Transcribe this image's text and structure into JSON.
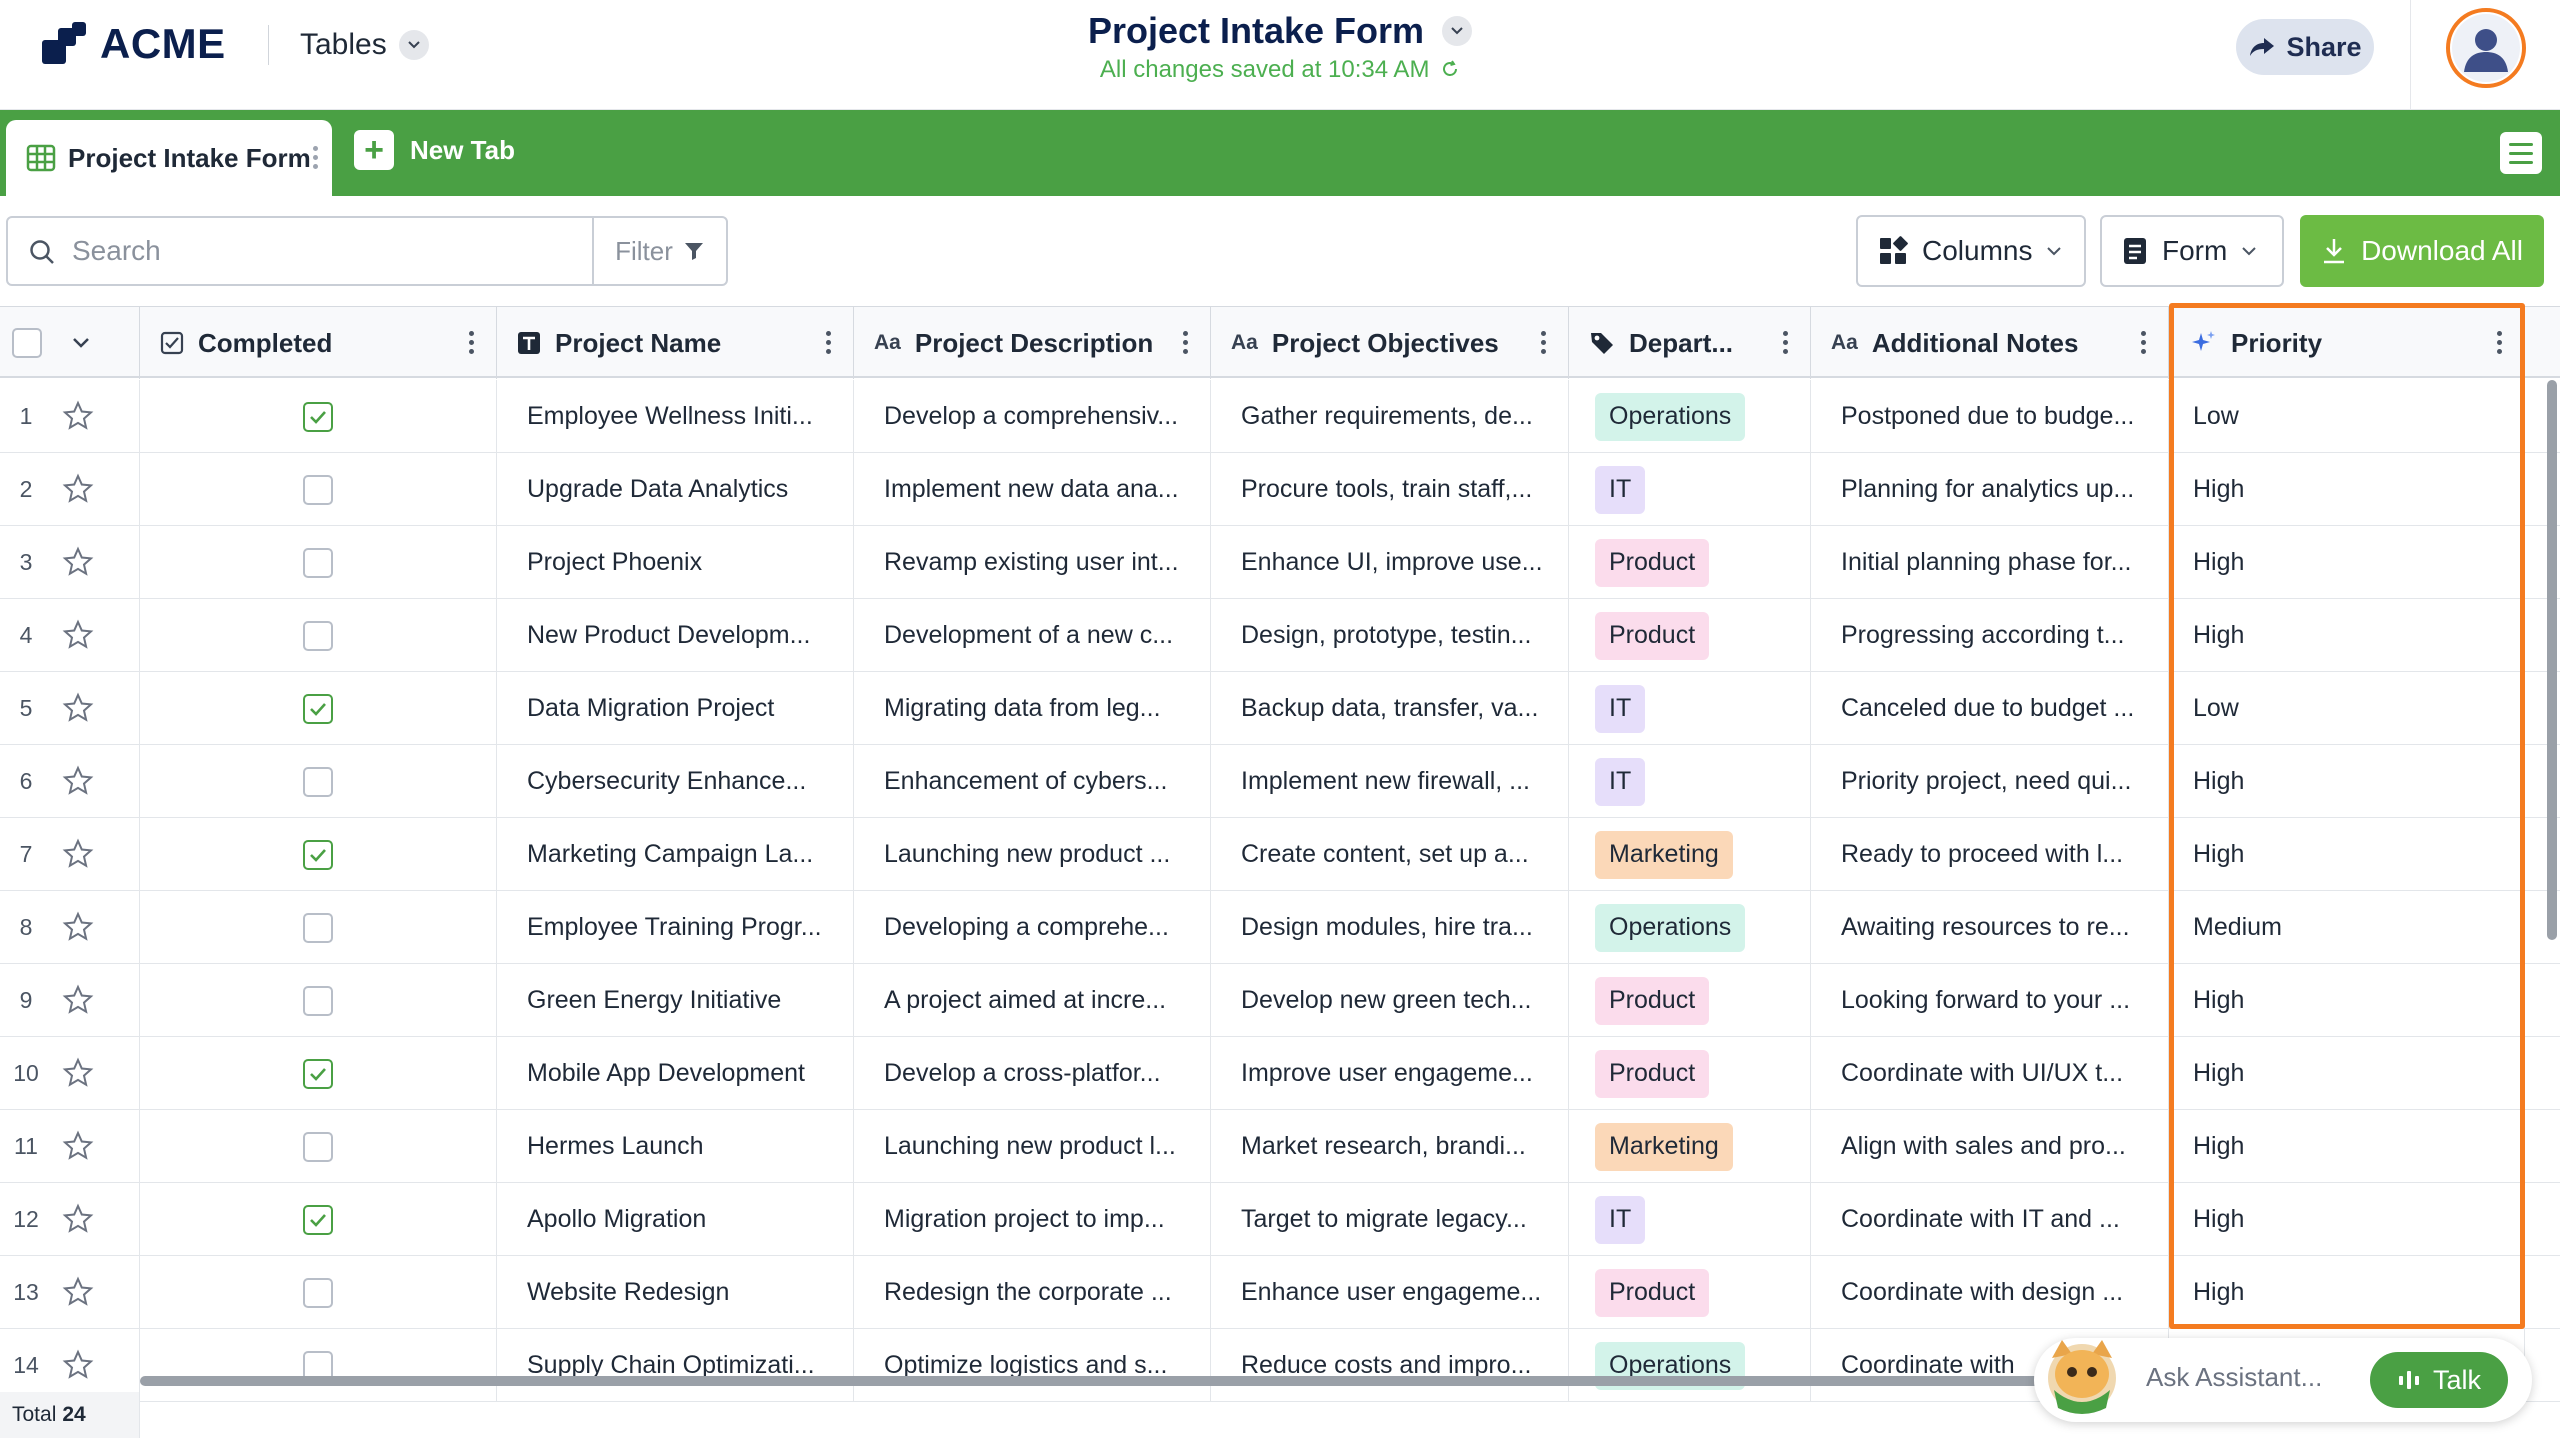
{
  "header": {
    "brand": "ACME",
    "tables_label": "Tables",
    "title": "Project Intake Form",
    "saved_status": "All changes saved at 10:34 AM",
    "share_label": "Share"
  },
  "tabs": {
    "active_label": "Project Intake Form",
    "new_tab_label": "New Tab"
  },
  "toolbar": {
    "search_placeholder": "Search",
    "filter_label": "Filter",
    "columns_label": "Columns",
    "form_label": "Form",
    "download_label": "Download All"
  },
  "columns": [
    {
      "label": "Completed",
      "icon": "checkbox-icon"
    },
    {
      "label": "Project Name",
      "icon": "text-t-icon"
    },
    {
      "label": "Project Description",
      "icon": "text-aa-icon"
    },
    {
      "label": "Project Objectives",
      "icon": "text-aa-icon"
    },
    {
      "label": "Depart...",
      "icon": "tag-icon"
    },
    {
      "label": "Additional Notes",
      "icon": "text-aa-icon"
    },
    {
      "label": "Priority",
      "icon": "sparkle-icon"
    }
  ],
  "rows": [
    {
      "num": "1",
      "completed": true,
      "name": "Employee Wellness Initi...",
      "description": "Develop a comprehensiv...",
      "objectives": "Gather requirements, de...",
      "department": "Operations",
      "notes": "Postponed due to budge...",
      "priority": "Low"
    },
    {
      "num": "2",
      "completed": false,
      "name": "Upgrade Data Analytics",
      "description": "Implement new data ana...",
      "objectives": "Procure tools, train staff,...",
      "department": "IT",
      "notes": "Planning for analytics up...",
      "priority": "High"
    },
    {
      "num": "3",
      "completed": false,
      "name": "Project Phoenix",
      "description": "Revamp existing user int...",
      "objectives": "Enhance UI, improve use...",
      "department": "Product",
      "notes": "Initial planning phase for...",
      "priority": "High"
    },
    {
      "num": "4",
      "completed": false,
      "name": "New Product Developm...",
      "description": "Development of a new c...",
      "objectives": "Design, prototype, testin...",
      "department": "Product",
      "notes": "Progressing according t...",
      "priority": "High"
    },
    {
      "num": "5",
      "completed": true,
      "name": "Data Migration Project",
      "description": "Migrating data from leg...",
      "objectives": "Backup data, transfer, va...",
      "department": "IT",
      "notes": "Canceled due to budget ...",
      "priority": "Low"
    },
    {
      "num": "6",
      "completed": false,
      "name": "Cybersecurity Enhance...",
      "description": "Enhancement of cybers...",
      "objectives": "Implement new firewall, ...",
      "department": "IT",
      "notes": "Priority project, need qui...",
      "priority": "High"
    },
    {
      "num": "7",
      "completed": true,
      "name": "Marketing Campaign La...",
      "description": "Launching new product ...",
      "objectives": "Create content, set up a...",
      "department": "Marketing",
      "notes": "Ready to proceed with l...",
      "priority": "High"
    },
    {
      "num": "8",
      "completed": false,
      "name": "Employee Training Progr...",
      "description": "Developing a comprehe...",
      "objectives": "Design modules, hire tra...",
      "department": "Operations",
      "notes": "Awaiting resources to re...",
      "priority": "Medium"
    },
    {
      "num": "9",
      "completed": false,
      "name": "Green Energy Initiative",
      "description": "A project aimed at incre...",
      "objectives": "Develop new green tech...",
      "department": "Product",
      "notes": "Looking forward to your ...",
      "priority": "High"
    },
    {
      "num": "10",
      "completed": true,
      "name": "Mobile App Development",
      "description": "Develop a cross-platfor...",
      "objectives": "Improve user engageme...",
      "department": "Product",
      "notes": "Coordinate with UI/UX t...",
      "priority": "High"
    },
    {
      "num": "11",
      "completed": false,
      "name": "Hermes Launch",
      "description": "Launching new product l...",
      "objectives": "Market research, brandi...",
      "department": "Marketing",
      "notes": "Align with sales and pro...",
      "priority": "High"
    },
    {
      "num": "12",
      "completed": true,
      "name": "Apollo Migration",
      "description": "Migration project to imp...",
      "objectives": "Target to migrate legacy...",
      "department": "IT",
      "notes": "Coordinate with IT and ...",
      "priority": "High"
    },
    {
      "num": "13",
      "completed": false,
      "name": "Website Redesign",
      "description": "Redesign the corporate ...",
      "objectives": "Enhance user engageme...",
      "department": "Product",
      "notes": "Coordinate with design ...",
      "priority": "High"
    },
    {
      "num": "14",
      "completed": false,
      "name": "Supply Chain Optimizati...",
      "description": "Optimize logistics and s...",
      "objectives": "Reduce costs and impro...",
      "department": "Operations",
      "notes": "Coordinate with",
      "priority": ""
    }
  ],
  "department_colors": {
    "Operations": "#d3f3ea",
    "IT": "#e6defa",
    "Product": "#fbdcec",
    "Marketing": "#fbd8b8"
  },
  "footer": {
    "total_label": "Total",
    "total_count": "24"
  },
  "assistant": {
    "placeholder": "Ask Assistant...",
    "talk_label": "Talk"
  },
  "colors": {
    "brand_navy": "#0b1f4d",
    "tab_green": "#4aa044",
    "download_green": "#6cbb44",
    "saved_green": "#4caf50",
    "highlight_orange": "#f47b20"
  }
}
